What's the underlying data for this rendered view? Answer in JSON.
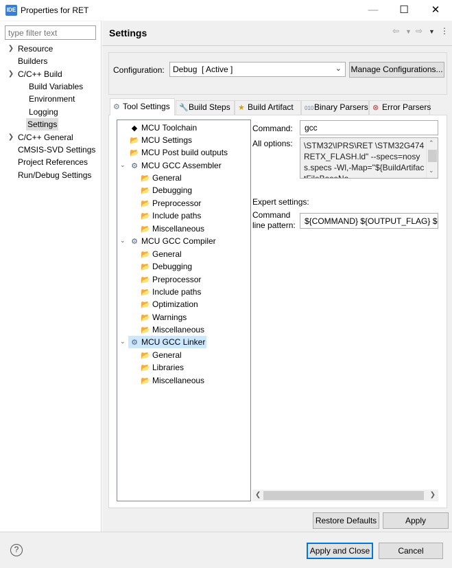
{
  "window": {
    "app_icon_text": "IDE",
    "title": "Properties for RET",
    "minimize": "—",
    "maximize": "☐",
    "close": "✕"
  },
  "left": {
    "filter_placeholder": "type filter text",
    "items": [
      {
        "label": "Resource"
      },
      {
        "label": "Builders"
      },
      {
        "label": "C/C++ Build"
      },
      {
        "label": "Build Variables"
      },
      {
        "label": "Environment"
      },
      {
        "label": "Logging"
      },
      {
        "label": "Settings"
      },
      {
        "label": "C/C++ General"
      },
      {
        "label": "CMSIS-SVD Settings"
      },
      {
        "label": "Project References"
      },
      {
        "label": "Run/Debug Settings"
      }
    ]
  },
  "header": {
    "title": "Settings"
  },
  "config": {
    "label": "Configuration:",
    "value": "Debug  [ Active ]",
    "manage_label": "Manage Configurations..."
  },
  "tabs": [
    {
      "label": "Tool Settings",
      "icon": "gear-icon"
    },
    {
      "label": "Build Steps",
      "icon": "wrench-icon"
    },
    {
      "label": "Build Artifact",
      "icon": "trophy-icon"
    },
    {
      "label": "Binary Parsers",
      "icon": "binary-icon"
    },
    {
      "label": "Error Parsers",
      "icon": "error-icon"
    }
  ],
  "tree": [
    {
      "label": "MCU Toolchain",
      "icon": "chip-icon"
    },
    {
      "label": "MCU Settings",
      "icon": "folder-icon"
    },
    {
      "label": "MCU Post build outputs",
      "icon": "folder-icon"
    },
    {
      "label": "MCU GCC Assembler",
      "icon": "gear-icon"
    },
    {
      "label": "General",
      "icon": "folder-icon"
    },
    {
      "label": "Debugging",
      "icon": "folder-icon"
    },
    {
      "label": "Preprocessor",
      "icon": "folder-icon"
    },
    {
      "label": "Include paths",
      "icon": "folder-icon"
    },
    {
      "label": "Miscellaneous",
      "icon": "folder-icon"
    },
    {
      "label": "MCU GCC Compiler",
      "icon": "gear-icon"
    },
    {
      "label": "General",
      "icon": "folder-icon"
    },
    {
      "label": "Debugging",
      "icon": "folder-icon"
    },
    {
      "label": "Preprocessor",
      "icon": "folder-icon"
    },
    {
      "label": "Include paths",
      "icon": "folder-icon"
    },
    {
      "label": "Optimization",
      "icon": "folder-icon"
    },
    {
      "label": "Warnings",
      "icon": "folder-icon"
    },
    {
      "label": "Miscellaneous",
      "icon": "folder-icon"
    },
    {
      "label": "MCU GCC Linker",
      "icon": "gear-icon"
    },
    {
      "label": "General",
      "icon": "folder-icon"
    },
    {
      "label": "Libraries",
      "icon": "folder-icon"
    },
    {
      "label": "Miscellaneous",
      "icon": "folder-icon"
    }
  ],
  "tool": {
    "command_label": "Command:",
    "command_value": "gcc",
    "all_options_label": "All options:",
    "all_options_value": "\\STM32\\IPRS\\RET \\STM32G474RETX_FLASH.ld\" --specs=nosys.specs -Wl,-Map=\"${BuildArtifactFileBaseNa",
    "expert_label": "Expert settings:",
    "cmdline_label_1": "Command",
    "cmdline_label_2": "line pattern:",
    "cmdline_value": "${COMMAND} ${OUTPUT_FLAG} ${OUTPUT_PREFIX}"
  },
  "buttons": {
    "restore": "Restore Defaults",
    "apply": "Apply",
    "apply_close": "Apply and Close",
    "cancel": "Cancel",
    "help": "?"
  }
}
